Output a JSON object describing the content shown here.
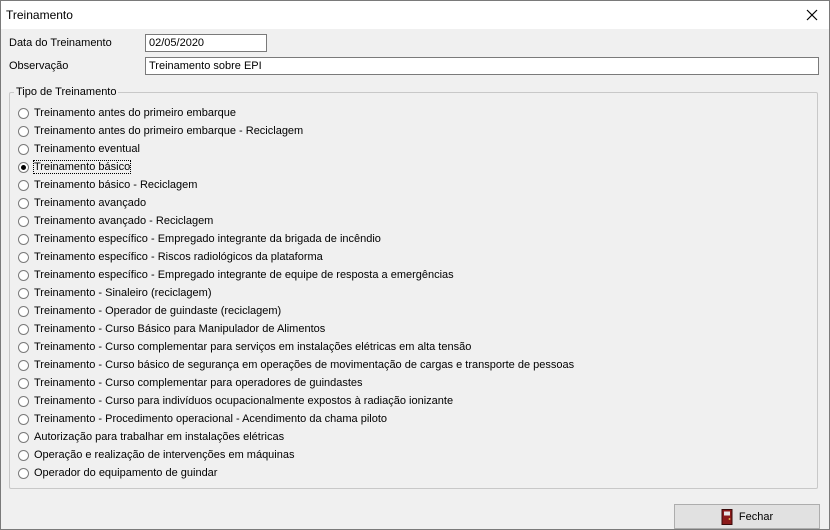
{
  "window": {
    "title": "Treinamento"
  },
  "form": {
    "date_label": "Data do Treinamento",
    "date_value": "02/05/2020",
    "obs_label": "Observação",
    "obs_value": "Treinamento sobre EPI"
  },
  "group": {
    "title": "Tipo de Treinamento",
    "selected_index": 3,
    "options": [
      "Treinamento antes do primeiro embarque",
      "Treinamento antes do primeiro embarque - Reciclagem",
      "Treinamento eventual",
      "Treinamento básico",
      "Treinamento básico - Reciclagem",
      "Treinamento avançado",
      "Treinamento avançado - Reciclagem",
      "Treinamento específico - Empregado integrante da brigada de incêndio",
      "Treinamento específico - Riscos radiológicos da plataforma",
      "Treinamento específico - Empregado integrante de equipe de resposta a emergências",
      "Treinamento - Sinaleiro (reciclagem)",
      "Treinamento - Operador de guindaste (reciclagem)",
      "Treinamento - Curso Básico para Manipulador de Alimentos",
      "Treinamento - Curso complementar para serviços em instalações elétricas em alta tensão",
      "Treinamento - Curso básico de segurança em operações de movimentação de cargas e transporte de pessoas",
      "Treinamento - Curso complementar para operadores de guindastes",
      "Treinamento - Curso para indivíduos ocupacionalmente expostos à radiação ionizante",
      "Treinamento - Procedimento operacional - Acendimento da chama piloto",
      "Autorização para trabalhar em instalações elétricas",
      "Operação e realização de intervenções em máquinas",
      "Operador do equipamento de guindar"
    ]
  },
  "footer": {
    "close_label": "Fechar",
    "close_icon": "door-exit-icon"
  }
}
